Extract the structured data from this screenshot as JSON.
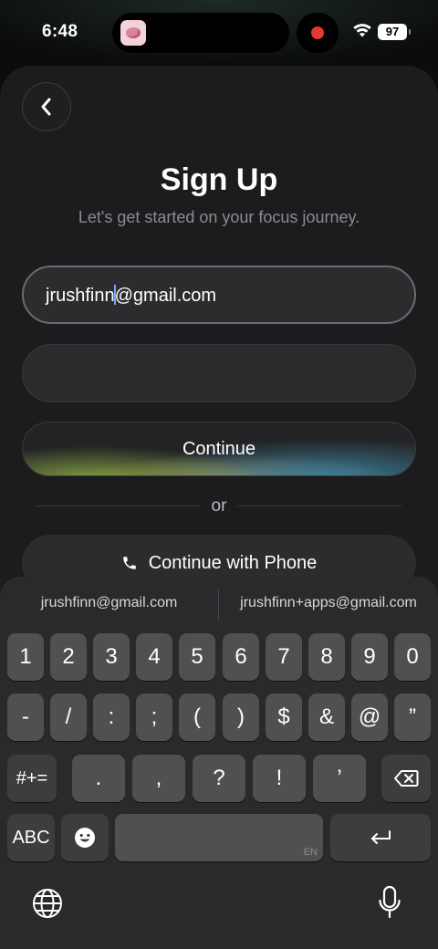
{
  "status": {
    "time": "6:48",
    "battery": "97"
  },
  "header": {
    "title": "Sign Up",
    "subtitle": "Let's get started on your focus journey."
  },
  "form": {
    "email_value_before_caret": "jrushfinn",
    "email_value_after_caret": "@gmail.com",
    "continue_label": "Continue",
    "or_label": "or",
    "phone_label": "Continue with Phone"
  },
  "keyboard": {
    "suggestions": [
      "jrushfinn@gmail.com",
      "jrushfinn+apps@gmail.com"
    ],
    "row1": [
      "1",
      "2",
      "3",
      "4",
      "5",
      "6",
      "7",
      "8",
      "9",
      "0"
    ],
    "row2": [
      "-",
      "/",
      ":",
      ";",
      "(",
      ")",
      "$",
      "&",
      "@",
      "”"
    ],
    "row3": [
      ".",
      ",",
      "?",
      "!",
      "’"
    ],
    "symbols_key": "#+=",
    "abc_key": "ABC",
    "language_tag": "EN"
  },
  "colors": {
    "caret": "#6ea6ff",
    "record": "#e23a2e"
  }
}
